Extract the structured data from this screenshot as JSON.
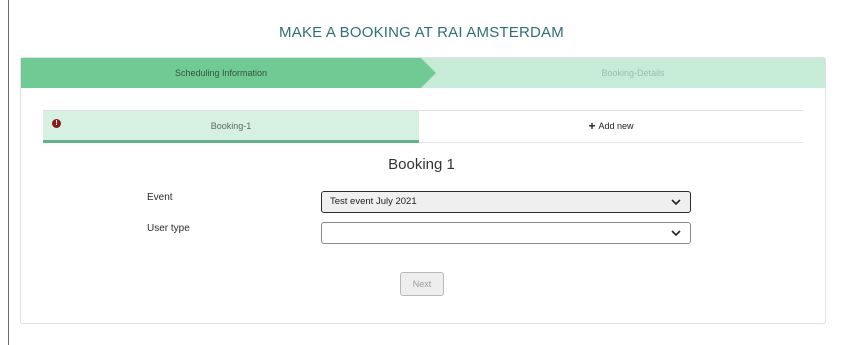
{
  "page": {
    "title": "MAKE A BOOKING AT RAI AMSTERDAM"
  },
  "steps": [
    {
      "label": "Scheduling Information",
      "active": true
    },
    {
      "label": "Booking-Details",
      "active": false
    }
  ],
  "tabs": {
    "booking_label": "Booking-1",
    "warning_symbol": "!",
    "add_symbol": "+",
    "add_label": "Add new"
  },
  "form": {
    "heading": "Booking 1",
    "event_label": "Event",
    "event_value": "Test event July 2021",
    "user_type_label": "User type",
    "user_type_value": ""
  },
  "actions": {
    "next_label": "Next"
  },
  "colors": {
    "accent": "#6fcb93",
    "accent_light": "#c6ecd8",
    "title": "#2f6f78",
    "warning": "#8b1a1a"
  },
  "icons": {
    "warning": "exclamation-circle-icon",
    "add": "plus-icon",
    "dropdown": "chevron-down-icon"
  }
}
